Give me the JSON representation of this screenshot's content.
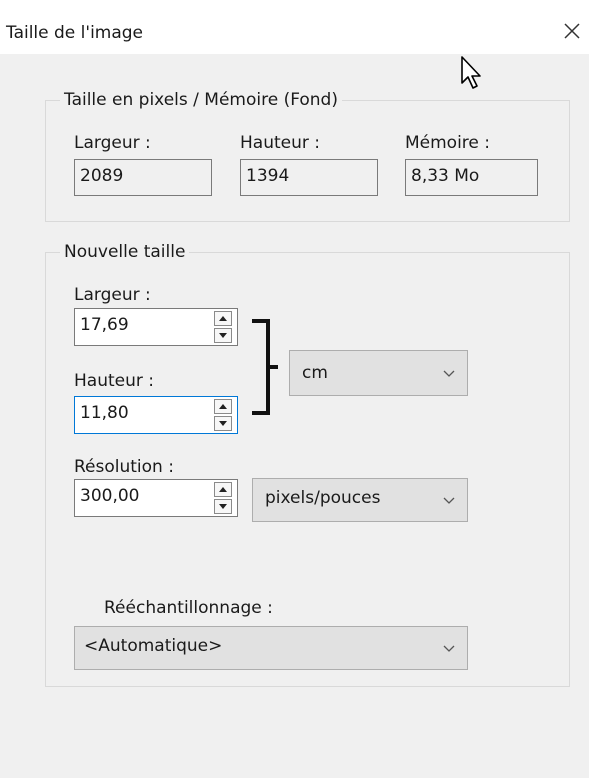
{
  "window": {
    "title": "Taille de l'image",
    "close_icon": "close-icon"
  },
  "pixel_size": {
    "legend": "Taille en pixels / Mémoire (Fond)",
    "width_label": "Largeur :",
    "width_value": "2089",
    "height_label": "Hauteur :",
    "height_value": "1394",
    "memory_label": "Mémoire :",
    "memory_value": "8,33 Mo"
  },
  "new_size": {
    "legend": "Nouvelle taille",
    "width_label": "Largeur :",
    "width_value": "17,69",
    "height_label": "Hauteur :",
    "height_value": "11,80",
    "unit_selected": "cm",
    "resolution_label": "Résolution :",
    "resolution_value": "300,00",
    "resolution_unit_selected": "pixels/pouces",
    "resampling_label": "Rééchantillonnage :",
    "resampling_selected": "<Automatique>"
  },
  "colors": {
    "dialog_background": "#f0f0f0",
    "title_background": "#ffffff",
    "focus_border": "#0078d7",
    "combo_background": "#e1e1e1"
  }
}
